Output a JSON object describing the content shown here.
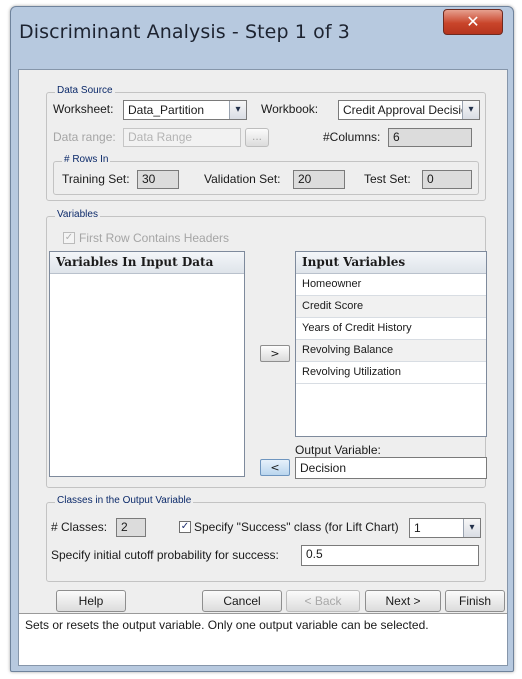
{
  "window": {
    "title": "Discriminant Analysis - Step 1 of 3",
    "close_glyph": "✕"
  },
  "data_source": {
    "group_label": "Data Source",
    "worksheet_label": "Worksheet:",
    "worksheet_value": "Data_Partition",
    "workbook_label": "Workbook:",
    "workbook_value": "Credit Approval Decisio",
    "data_range_label": "Data range:",
    "data_range_value": "Data Range",
    "data_range_button": "...",
    "columns_label": "#Columns:",
    "columns_value": "6",
    "rows_in": {
      "group_label": "# Rows In",
      "training_label": "Training Set:",
      "training_value": "30",
      "validation_label": "Validation Set:",
      "validation_value": "20",
      "test_label": "Test Set:",
      "test_value": "0"
    }
  },
  "variables": {
    "group_label": "Variables",
    "first_row_headers_label": "First Row Contains Headers",
    "first_row_headers_checked": true,
    "input_data_header": "Variables In Input Data",
    "input_variables_header": "Input Variables",
    "input_variables": [
      "Homeowner",
      "Credit Score",
      "Years of Credit History",
      "Revolving Balance",
      "Revolving Utilization"
    ],
    "add_button": ">",
    "remove_button": "<",
    "output_label": "Output Variable:",
    "output_value": "Decision"
  },
  "classes": {
    "group_label": "Classes in the Output Variable",
    "num_classes_label": "# Classes:",
    "num_classes_value": "2",
    "specify_success_label": "Specify \"Success\" class (for Lift Chart)",
    "specify_success_checked": true,
    "success_class_value": "1",
    "cutoff_label": "Specify initial cutoff probability for success:",
    "cutoff_value": "0.5"
  },
  "buttons": {
    "help": "Help",
    "cancel": "Cancel",
    "back": "< Back",
    "next": "Next >",
    "finish": "Finish"
  },
  "status_text": "Sets or resets the output variable. Only one output variable can be selected.",
  "icons": {
    "checkmark": "✓",
    "dropdown": "▾"
  }
}
